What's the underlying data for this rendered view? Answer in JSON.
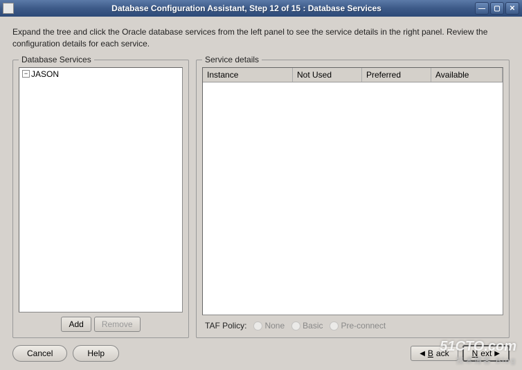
{
  "window": {
    "title": "Database Configuration Assistant, Step 12 of 15 : Database Services"
  },
  "instructions": "Expand the tree and click the Oracle database services from the left panel to see the service details in the right panel. Review the configuration details for each service.",
  "dbServices": {
    "legend": "Database Services",
    "tree": {
      "root": "JASON"
    },
    "buttons": {
      "add": "Add",
      "remove": "Remove"
    }
  },
  "serviceDetails": {
    "legend": "Service details",
    "columns": {
      "instance": "Instance",
      "notUsed": "Not Used",
      "preferred": "Preferred",
      "available": "Available"
    },
    "taf": {
      "label": "TAF Policy:",
      "none": "None",
      "basic": "Basic",
      "preconnect": "Pre-connect"
    }
  },
  "nav": {
    "cancel": "Cancel",
    "help": "Help",
    "back": "Back",
    "next": "Next"
  },
  "watermark": {
    "main": "51CTO.com",
    "sub": "技术博客    Blog"
  }
}
